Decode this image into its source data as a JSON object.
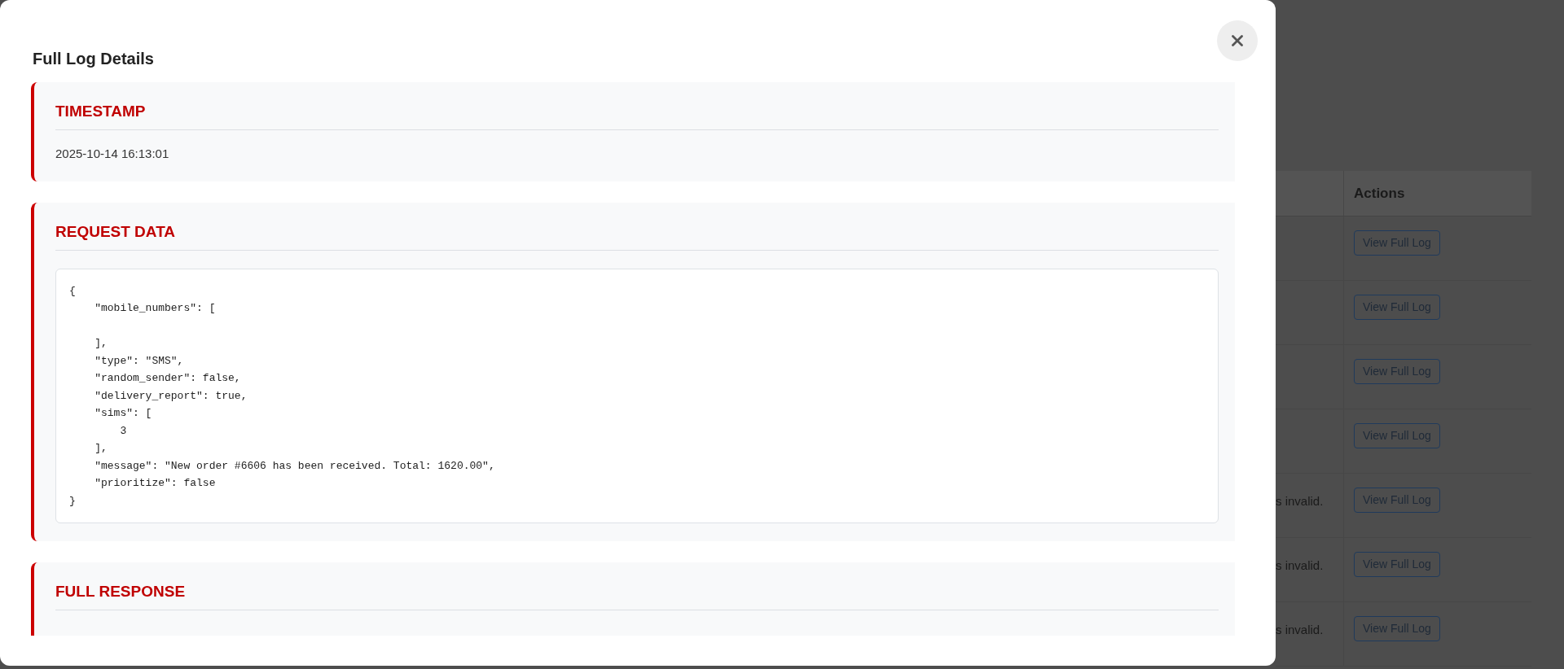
{
  "modal": {
    "title": "Full Log Details",
    "sections": [
      {
        "kind": "text",
        "heading": "TIMESTAMP",
        "value": "2025-10-14 16:13:01"
      },
      {
        "kind": "code",
        "heading": "REQUEST DATA",
        "code": "{\n    \"mobile_numbers\": [\n\n    ],\n    \"type\": \"SMS\",\n    \"random_sender\": false,\n    \"delivery_report\": true,\n    \"sims\": [\n        3\n    ],\n    \"message\": \"New order #6606 has been received. Total: 1620.00\",\n    \"prioritize\": false\n}"
      },
      {
        "kind": "empty",
        "heading": "FULL RESPONSE"
      }
    ]
  },
  "background_table": {
    "columns": [
      "Actions"
    ],
    "rows": [
      {
        "button": "View Full Log"
      },
      {
        "button": "View Full Log"
      },
      {
        "button": "View Full Log"
      },
      {
        "button": "View Full Log"
      },
      {
        "cell": "s invalid.",
        "button": "View Full Log"
      },
      {
        "cell": "s invalid.",
        "button": "View Full Log"
      },
      {
        "cell": "s invalid.",
        "button": "View Full Log"
      }
    ]
  }
}
